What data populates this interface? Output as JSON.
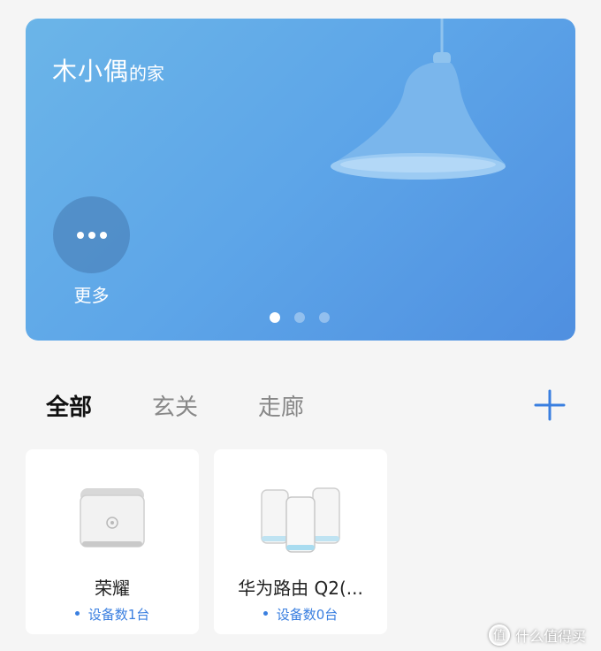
{
  "home": {
    "name": "木小偶",
    "suffix": "的家",
    "more_label": "更多",
    "pager": {
      "count": 3,
      "active": 0
    }
  },
  "tabs": [
    {
      "label": "全部",
      "active": true
    },
    {
      "label": "玄关",
      "active": false
    },
    {
      "label": "走廊",
      "active": false
    }
  ],
  "add_icon": "plus-icon",
  "devices": [
    {
      "name": "荣耀",
      "count_text": "设备数1台",
      "icon": "router-box-icon"
    },
    {
      "name": "华为路由 Q2(...",
      "count_text": "设备数0台",
      "icon": "mesh-router-icon"
    }
  ],
  "watermark": {
    "text": "什么值得买",
    "mark": "值"
  },
  "colors": {
    "accent": "#3a7fe0",
    "banner": "#5da5e8",
    "background": "#f5f5f5"
  }
}
